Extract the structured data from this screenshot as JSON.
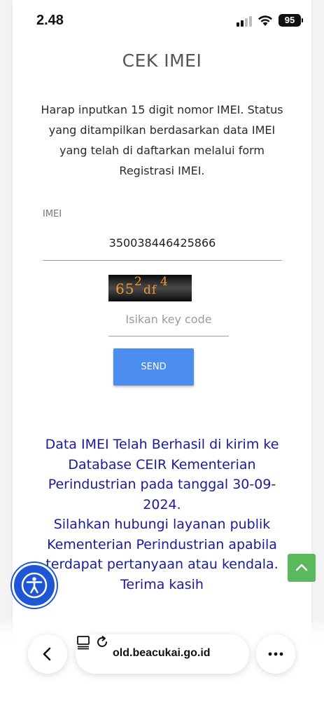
{
  "status_bar": {
    "time": "2.48",
    "battery": "95",
    "icons": [
      "signal-icon",
      "wifi-icon",
      "battery-icon"
    ]
  },
  "page": {
    "title": "CEK IMEI",
    "description": "Harap inputkan 15 digit nomor IMEI. Status yang ditampilkan berdasarkan data IMEI yang telah di daftarkan melalui form Registrasi IMEI."
  },
  "form": {
    "imei_label": "IMEI",
    "imei_value": "350038446425866",
    "captcha_main": "65",
    "captcha_sup1": "2",
    "captcha_mid": "df",
    "captcha_sup2": "4",
    "key_placeholder": "Isikan key code",
    "send_label": "SEND"
  },
  "result": {
    "message_line1": "Data IMEI Telah Berhasil di kirim ke Database CEIR Kementerian Perindustrian pada tanggal 30-09-2024.",
    "message_line2": "Silahkan hubungi layanan publik Kementerian Perindustrian apabila terdapat pertanyaan atau kendala.",
    "message_line3": "Terima kasih",
    "color": "#1a1a9a"
  },
  "floating": {
    "scroll_top_icon": "chevron-up-icon",
    "accessibility_icon": "accessibility-icon",
    "scroll_top_color": "#5cb85c",
    "accessibility_color": "#1e56d6"
  },
  "browser": {
    "url": "old.beacukai.go.id",
    "icons": [
      "chevron-left-icon",
      "page-icon",
      "reload-icon",
      "more-icon"
    ]
  },
  "colors": {
    "send_button": "#4c8df0"
  }
}
